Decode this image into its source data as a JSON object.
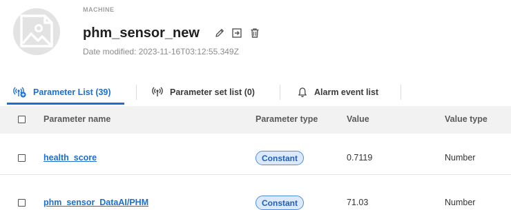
{
  "header": {
    "category": "MACHINE",
    "title": "phm_sensor_new",
    "modified": "Date modified: 2023-11-16T03:12:55.349Z",
    "icons": [
      "image-placeholder-icon",
      "edit-pencil-icon",
      "move-to-icon",
      "trash-icon"
    ]
  },
  "tabs": [
    {
      "label": "Parameter List (39)",
      "icon": "parameter-list-icon",
      "active": true
    },
    {
      "label": "Parameter set list (0)",
      "icon": "parameter-set-icon",
      "active": false
    },
    {
      "label": "Alarm event list",
      "icon": "bell-icon",
      "active": false
    }
  ],
  "table": {
    "columns": [
      "Parameter name",
      "Parameter type",
      "Value",
      "Value type"
    ],
    "rows": [
      {
        "name": "health_score",
        "type": "Constant",
        "value": "0.7119",
        "value_type": "Number"
      },
      {
        "name": "phm_sensor_DataAI/PHM",
        "type": "Constant",
        "value": "71.03",
        "value_type": "Number"
      }
    ]
  },
  "colors": {
    "accent": "#1b6fd3",
    "chip_bg": "#dbe9fb",
    "header_bg": "#f2f2f2"
  }
}
